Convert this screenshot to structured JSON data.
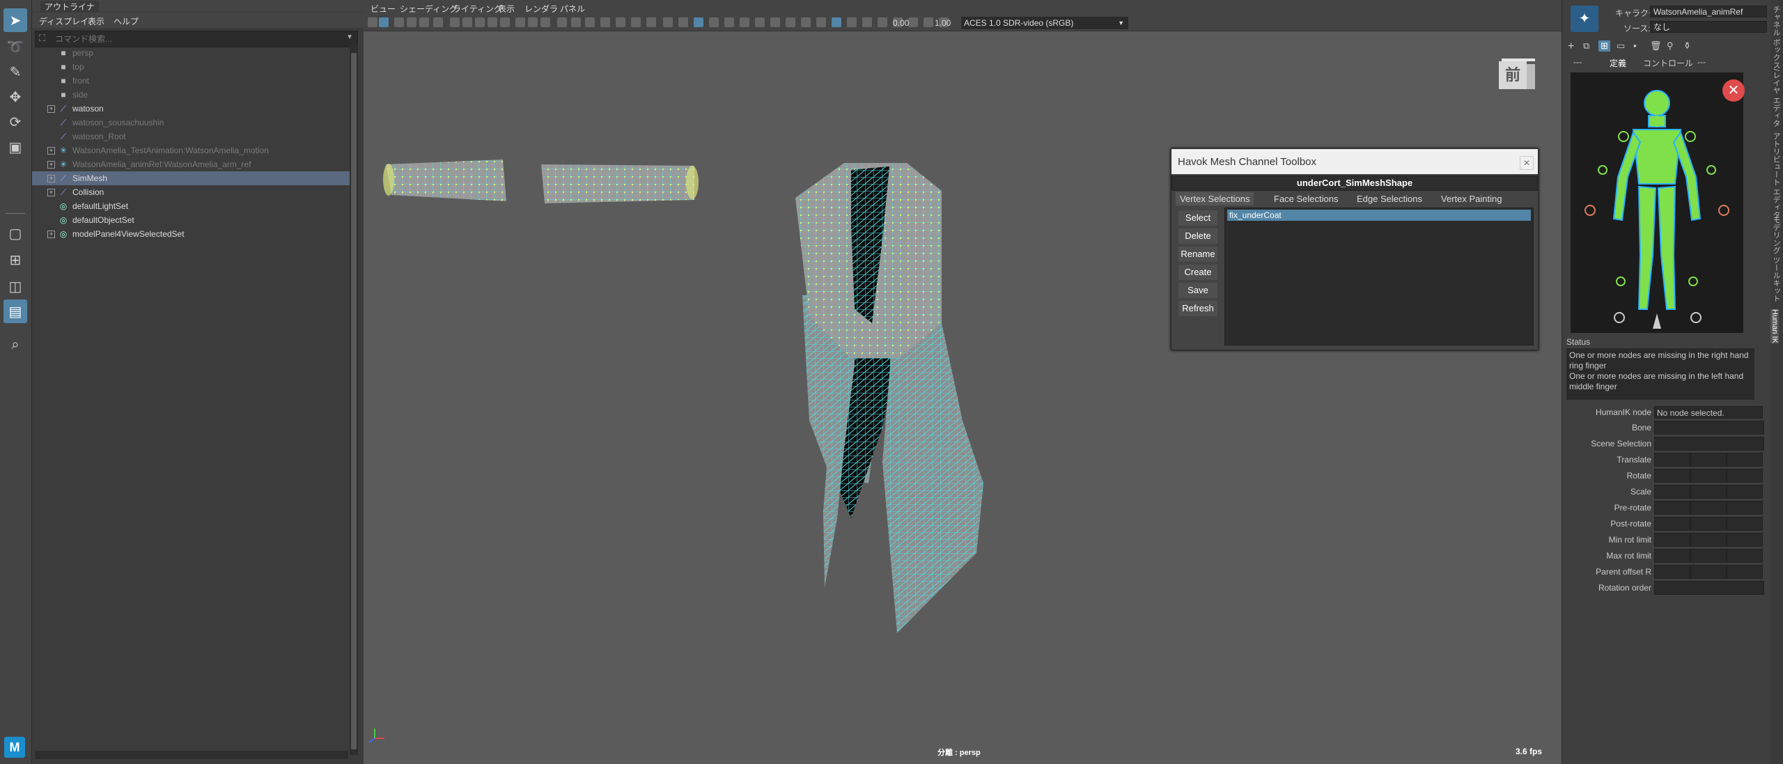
{
  "outliner": {
    "tab": "アウトライナ",
    "menu": [
      "ディスプレイ",
      "表示",
      "ヘルプ"
    ],
    "search_placeholder": "コマンド検索...",
    "items": [
      {
        "label": "persp",
        "dim": true
      },
      {
        "label": "top",
        "dim": true
      },
      {
        "label": "front",
        "dim": true
      },
      {
        "label": "side",
        "dim": true
      },
      {
        "label": "watoson",
        "dim": false
      },
      {
        "label": "watoson_sousachuushin",
        "dim": true
      },
      {
        "label": "watoson_Root",
        "dim": true
      },
      {
        "label": "WatsonAmelia_TestAnimation:WatsonAmelia_motion",
        "dim": true
      },
      {
        "label": "WatsonAmelia_animRef:WatsonAmelia_arm_ref",
        "dim": true
      },
      {
        "label": "SimMesh",
        "dim": false
      },
      {
        "label": "Collision",
        "dim": false
      },
      {
        "label": "defaultLightSet",
        "dim": false
      },
      {
        "label": "defaultObjectSet",
        "dim": false
      },
      {
        "label": "modelPanel4ViewSelectedSet",
        "dim": false
      }
    ]
  },
  "viewport": {
    "menu": [
      "ビュー",
      "シェーディング",
      "ライティング",
      "表示",
      "レンダラ",
      "パネル"
    ],
    "exposure": "0.00",
    "gamma": "1.00",
    "color_space": "ACES 1.0 SDR-video (sRGB)",
    "view_cube_label": "前",
    "camera_label": "分離 : persp",
    "fps": "3.6 fps"
  },
  "havok": {
    "title": "Havok Mesh Channel Toolbox",
    "shape": "underCort_SimMeshShape",
    "tabs": [
      "Vertex Selections",
      "Face Selections",
      "Edge Selections",
      "Vertex Painting"
    ],
    "buttons": [
      "Select",
      "Delete",
      "Rename",
      "Create",
      "Save",
      "Refresh"
    ],
    "selection": "fix_underCoat"
  },
  "hik": {
    "character_label": "キャラクタ:",
    "character_value": "WatsonAmelia_animRef",
    "source_label": "ソース:",
    "source_value": "なし",
    "tabs": [
      "---",
      "定義",
      "コントロール",
      "---"
    ],
    "status_title": "Status",
    "status_lines": [
      "One or more nodes are missing in the right hand ring finger",
      "One or more nodes are missing in the left hand middle finger"
    ],
    "node_label": "HumanIK node",
    "node_value": "No node selected.",
    "props": [
      "Bone",
      "Scene Selection",
      "Translate",
      "Rotate",
      "Scale",
      "Pre-rotate",
      "Post-rotate",
      "Min rot limit",
      "Max rot limit",
      "Parent offset R",
      "Rotation order"
    ],
    "side_tabs": [
      "チャネル ボックス/レイヤ エディタ",
      "アトリビュート エディタ",
      "モデリング ツールキット",
      "Human IK"
    ]
  },
  "colors": {
    "accent": "#5285a6",
    "mesh_wire": "#4fd6e0",
    "vertex": "#e6f06a"
  }
}
